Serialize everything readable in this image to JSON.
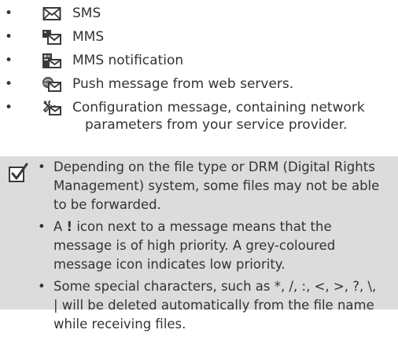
{
  "bullets": [
    {
      "text": "SMS",
      "icon": "sms-envelope-icon"
    },
    {
      "text": "MMS",
      "icon": "mms-envelope-icon"
    },
    {
      "text": "MMS notification",
      "icon": "mms-notification-icon"
    },
    {
      "text": "Push message from web servers.",
      "icon": "push-message-icon"
    },
    {
      "text_line1": "Configuration message, containing network",
      "text_line2": "parameters from your service provider.",
      "icon": "configuration-message-icon"
    }
  ],
  "bullet_symbol": "•",
  "note": {
    "icon": "checkbox-note-icon",
    "items": [
      "Depending on the file type or DRM (Digital Rights Management) system, some files may not be able to be forwarded.",
      {
        "before": "A ",
        "emphasis": "!",
        "after": " icon next to a message means that the message is of high priority. A grey-coloured message icon indicates low priority."
      },
      "Some special characters, such as *, /, :, <, >, ?, \\, | will be deleted automatically from the file name while receiving files."
    ]
  },
  "colors": {
    "text": "#333333",
    "note_background": "#dcdcdc",
    "icon_dark": "#3a3a3a",
    "icon_accent": "#6a8a5a"
  }
}
